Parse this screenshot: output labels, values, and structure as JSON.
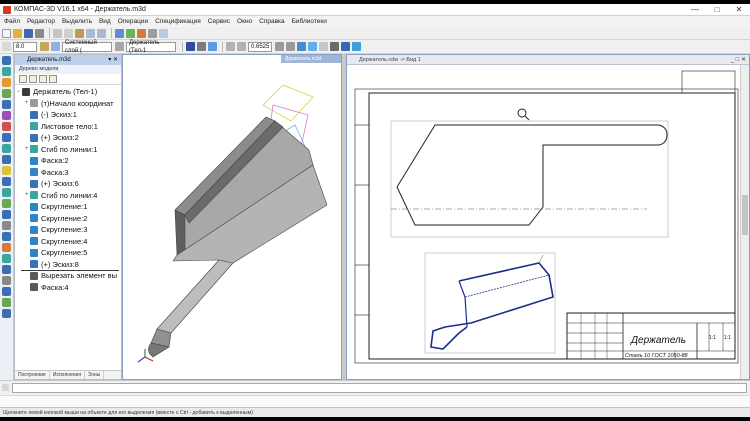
{
  "window": {
    "title": "КОМПАС-3D V16.1 x64 - Держатель.m3d",
    "controls": [
      "—",
      "□",
      "✕"
    ]
  },
  "menu": [
    "Файл",
    "Редактор",
    "Выделить",
    "Вид",
    "Операции",
    "Спецификация",
    "Сервис",
    "Окно",
    "Справка",
    "Библиотеки"
  ],
  "toolbar2": {
    "step_value": "8.0",
    "layer_value": "Системный слой (",
    "part_value": "Держатель (Тел-1",
    "zoom_value": "0.6525"
  },
  "tree_panel": {
    "doc_title": "Держатель.m3d",
    "header": "Дерево модели",
    "root": "Держатель (Тел-1)",
    "items": [
      {
        "label": "(т)Начало координат",
        "exp": "+",
        "icon_color": "#9a9a9a"
      },
      {
        "label": "(-) Эскиз:1",
        "exp": "",
        "icon_color": "#3d6fb8"
      },
      {
        "label": "Листовое тело:1",
        "exp": "",
        "icon_color": "#39a7a0"
      },
      {
        "label": "(+) Эскиз:2",
        "exp": "",
        "icon_color": "#3d6fb8"
      },
      {
        "label": "Сгиб по линии:1",
        "exp": "+",
        "icon_color": "#39a7a0"
      },
      {
        "label": "Фаска:2",
        "exp": "",
        "icon_color": "#2f84c9"
      },
      {
        "label": "Фаска:3",
        "exp": "",
        "icon_color": "#2f84c9"
      },
      {
        "label": "(+) Эскиз:6",
        "exp": "",
        "icon_color": "#3d6fb8"
      },
      {
        "label": "Сгиб по линии:4",
        "exp": "+",
        "icon_color": "#39a7a0"
      },
      {
        "label": "Скругление:1",
        "exp": "",
        "icon_color": "#2f84c9"
      },
      {
        "label": "Скругление:2",
        "exp": "",
        "icon_color": "#2f84c9"
      },
      {
        "label": "Скругление:3",
        "exp": "",
        "icon_color": "#2f84c9"
      },
      {
        "label": "Скругление:4",
        "exp": "",
        "icon_color": "#2f84c9"
      },
      {
        "label": "Скругление:5",
        "exp": "",
        "icon_color": "#2f84c9"
      },
      {
        "label": "(+) Эскиз:8",
        "exp": "",
        "icon_color": "#3d6fb8"
      },
      {
        "label": "Вырезать элемент вы",
        "exp": "",
        "icon_color": "#5a5a5a"
      },
      {
        "label": "Фаска:4",
        "exp": "",
        "icon_color": "#5a5a5a"
      }
    ],
    "tabs": [
      "Построение",
      "Исполнения",
      "Зоны"
    ]
  },
  "view3d": {
    "doc_tab": "Держатель.m3d"
  },
  "view2d": {
    "doc_title": "Держатель.cdw -> Вид 1",
    "title_block": {
      "name": "Держатель",
      "material": "Сталь 10  ГОСТ 1050-88",
      "sheet": "1:1",
      "scale": "1:1"
    }
  },
  "statusbar": {
    "text": "Щелкните левой кнопкой мыши на объекте для его выделения (вместе с Ctrl - добавить к выделенным)"
  },
  "colors": {
    "model_dark": "#5f5f5f",
    "model_light": "#a8a8a8",
    "panel_head": "#bcd0ea",
    "selection_blue": "#1a2f8a"
  }
}
